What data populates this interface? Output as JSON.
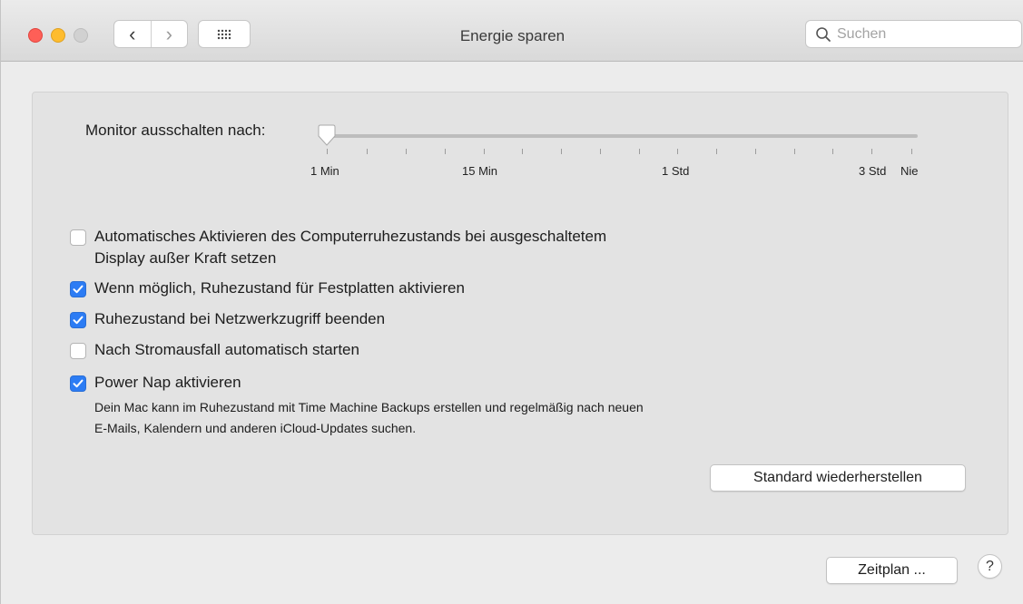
{
  "window": {
    "title": "Energie sparen",
    "traffic_colors": {
      "close": "#fe5f57",
      "minimize": "#febc2e",
      "zoom": "#d1d1d1"
    }
  },
  "toolbar": {
    "back_icon": "chevron-left-icon",
    "forward_icon": "chevron-right-icon",
    "show_all_icon": "grid-icon",
    "back_glyph": "‹",
    "forward_glyph": "›"
  },
  "search": {
    "placeholder": "Suchen",
    "value": ""
  },
  "display_sleep": {
    "label": "Monitor ausschalten nach:",
    "value": "1 Min",
    "tick_labels": [
      "1 Min",
      "15 Min",
      "1 Std",
      "3 Std",
      "Nie"
    ]
  },
  "options": [
    {
      "lines": [
        "Automatisches Aktivieren des Computerruhezustands bei ausgeschaltetem",
        "Display außer Kraft setzen"
      ],
      "checked": false
    },
    {
      "lines": [
        "Wenn möglich, Ruhezustand für Festplatten aktivieren"
      ],
      "checked": true
    },
    {
      "lines": [
        "Ruhezustand bei Netzwerkzugriff beenden"
      ],
      "checked": true
    },
    {
      "lines": [
        "Nach Stromausfall automatisch starten"
      ],
      "checked": false
    },
    {
      "lines": [
        "Power Nap aktivieren"
      ],
      "checked": true
    }
  ],
  "power_nap_description": [
    "Dein Mac kann im Ruhezustand mit Time Machine Backups erstellen und regelmäßig nach neuen",
    "E-Mails, Kalendern und anderen iCloud-Updates suchen."
  ],
  "buttons": {
    "restore_defaults": "Standard wiederherstellen",
    "schedule": "Zeitplan ...",
    "help": "?"
  },
  "accent_color": "#2c7cf4"
}
